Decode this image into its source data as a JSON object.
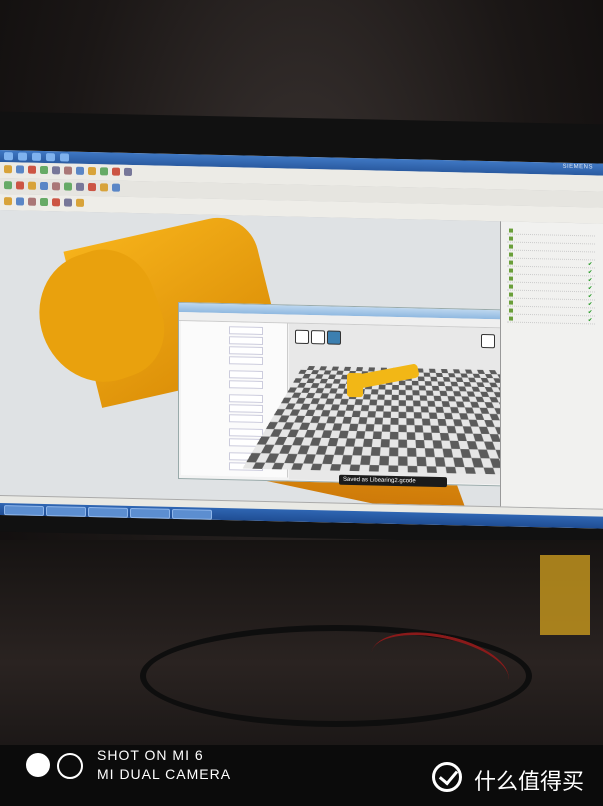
{
  "photo_watermark": {
    "line1": "SHOT ON MI 6",
    "line2": "MI DUAL CAMERA"
  },
  "site_watermark": {
    "text": "什么值得买"
  },
  "monitor": {
    "brand": "SIEMENS"
  },
  "slicer_window": {
    "status_text": "Saved as Libearing2.gcode",
    "colors": {
      "part": "#f2b716",
      "plate_dark": "#5b5b5b",
      "plate_light": "#e6e6e6"
    }
  },
  "cad_viewport": {
    "colors": {
      "model": "#f0a316",
      "background": "#dfe2e4"
    }
  }
}
